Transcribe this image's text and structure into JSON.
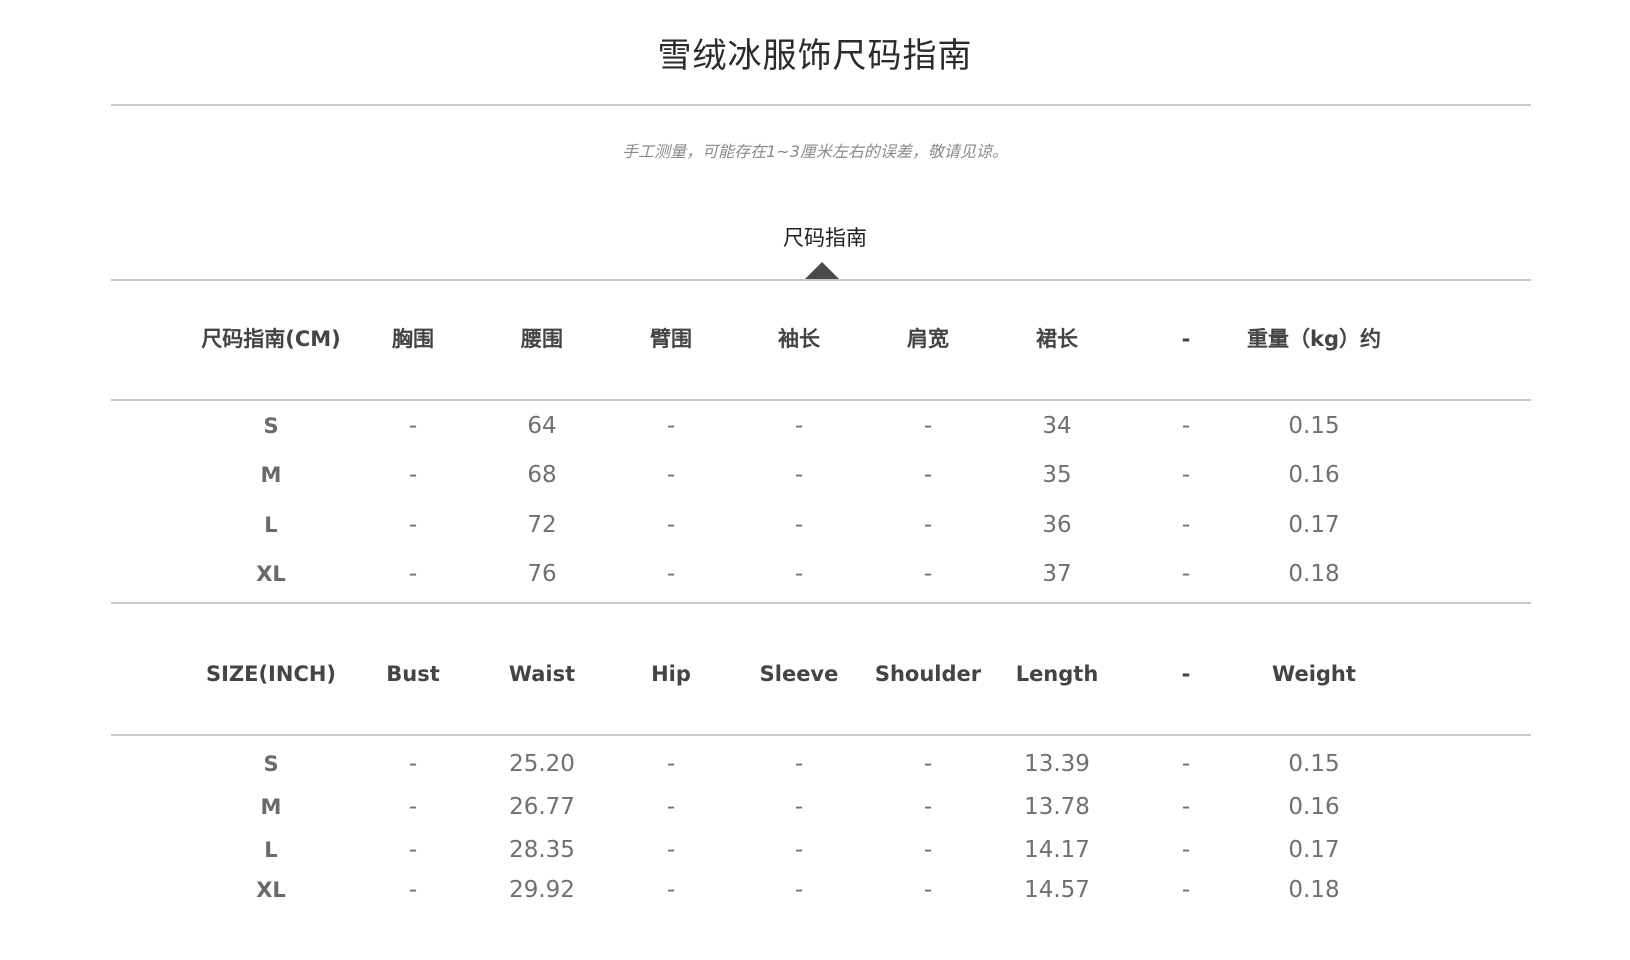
{
  "title": "雪绒冰服饰尺码指南",
  "note": "手工测量，可能存在1~3厘米左右的误差，敬请见谅。",
  "tab_label": "尺码指南",
  "cm_table": {
    "headers": [
      "尺码指南(CM)",
      "胸围",
      "腰围",
      "臂围",
      "袖长",
      "肩宽",
      "裙长",
      "-",
      "重量（kg）约"
    ],
    "rows": [
      [
        "S",
        "-",
        "64",
        "-",
        "-",
        "-",
        "34",
        "-",
        "0.15"
      ],
      [
        "M",
        "-",
        "68",
        "-",
        "-",
        "-",
        "35",
        "-",
        "0.16"
      ],
      [
        "L",
        "-",
        "72",
        "-",
        "-",
        "-",
        "36",
        "-",
        "0.17"
      ],
      [
        "XL",
        "-",
        "76",
        "-",
        "-",
        "-",
        "37",
        "-",
        "0.18"
      ]
    ]
  },
  "inch_table": {
    "headers": [
      "SIZE(INCH)",
      "Bust",
      "Waist",
      "Hip",
      "Sleeve",
      "Shoulder",
      "Length",
      "-",
      "Weight"
    ],
    "rows": [
      [
        "S",
        "-",
        "25.20",
        "-",
        "-",
        "-",
        "13.39",
        "-",
        "0.15"
      ],
      [
        "M",
        "-",
        "26.77",
        "-",
        "-",
        "-",
        "13.78",
        "-",
        "0.16"
      ],
      [
        "L",
        "-",
        "28.35",
        "-",
        "-",
        "-",
        "14.17",
        "-",
        "0.17"
      ],
      [
        "XL",
        "-",
        "29.92",
        "-",
        "-",
        "-",
        "14.57",
        "-",
        "0.18"
      ]
    ]
  }
}
